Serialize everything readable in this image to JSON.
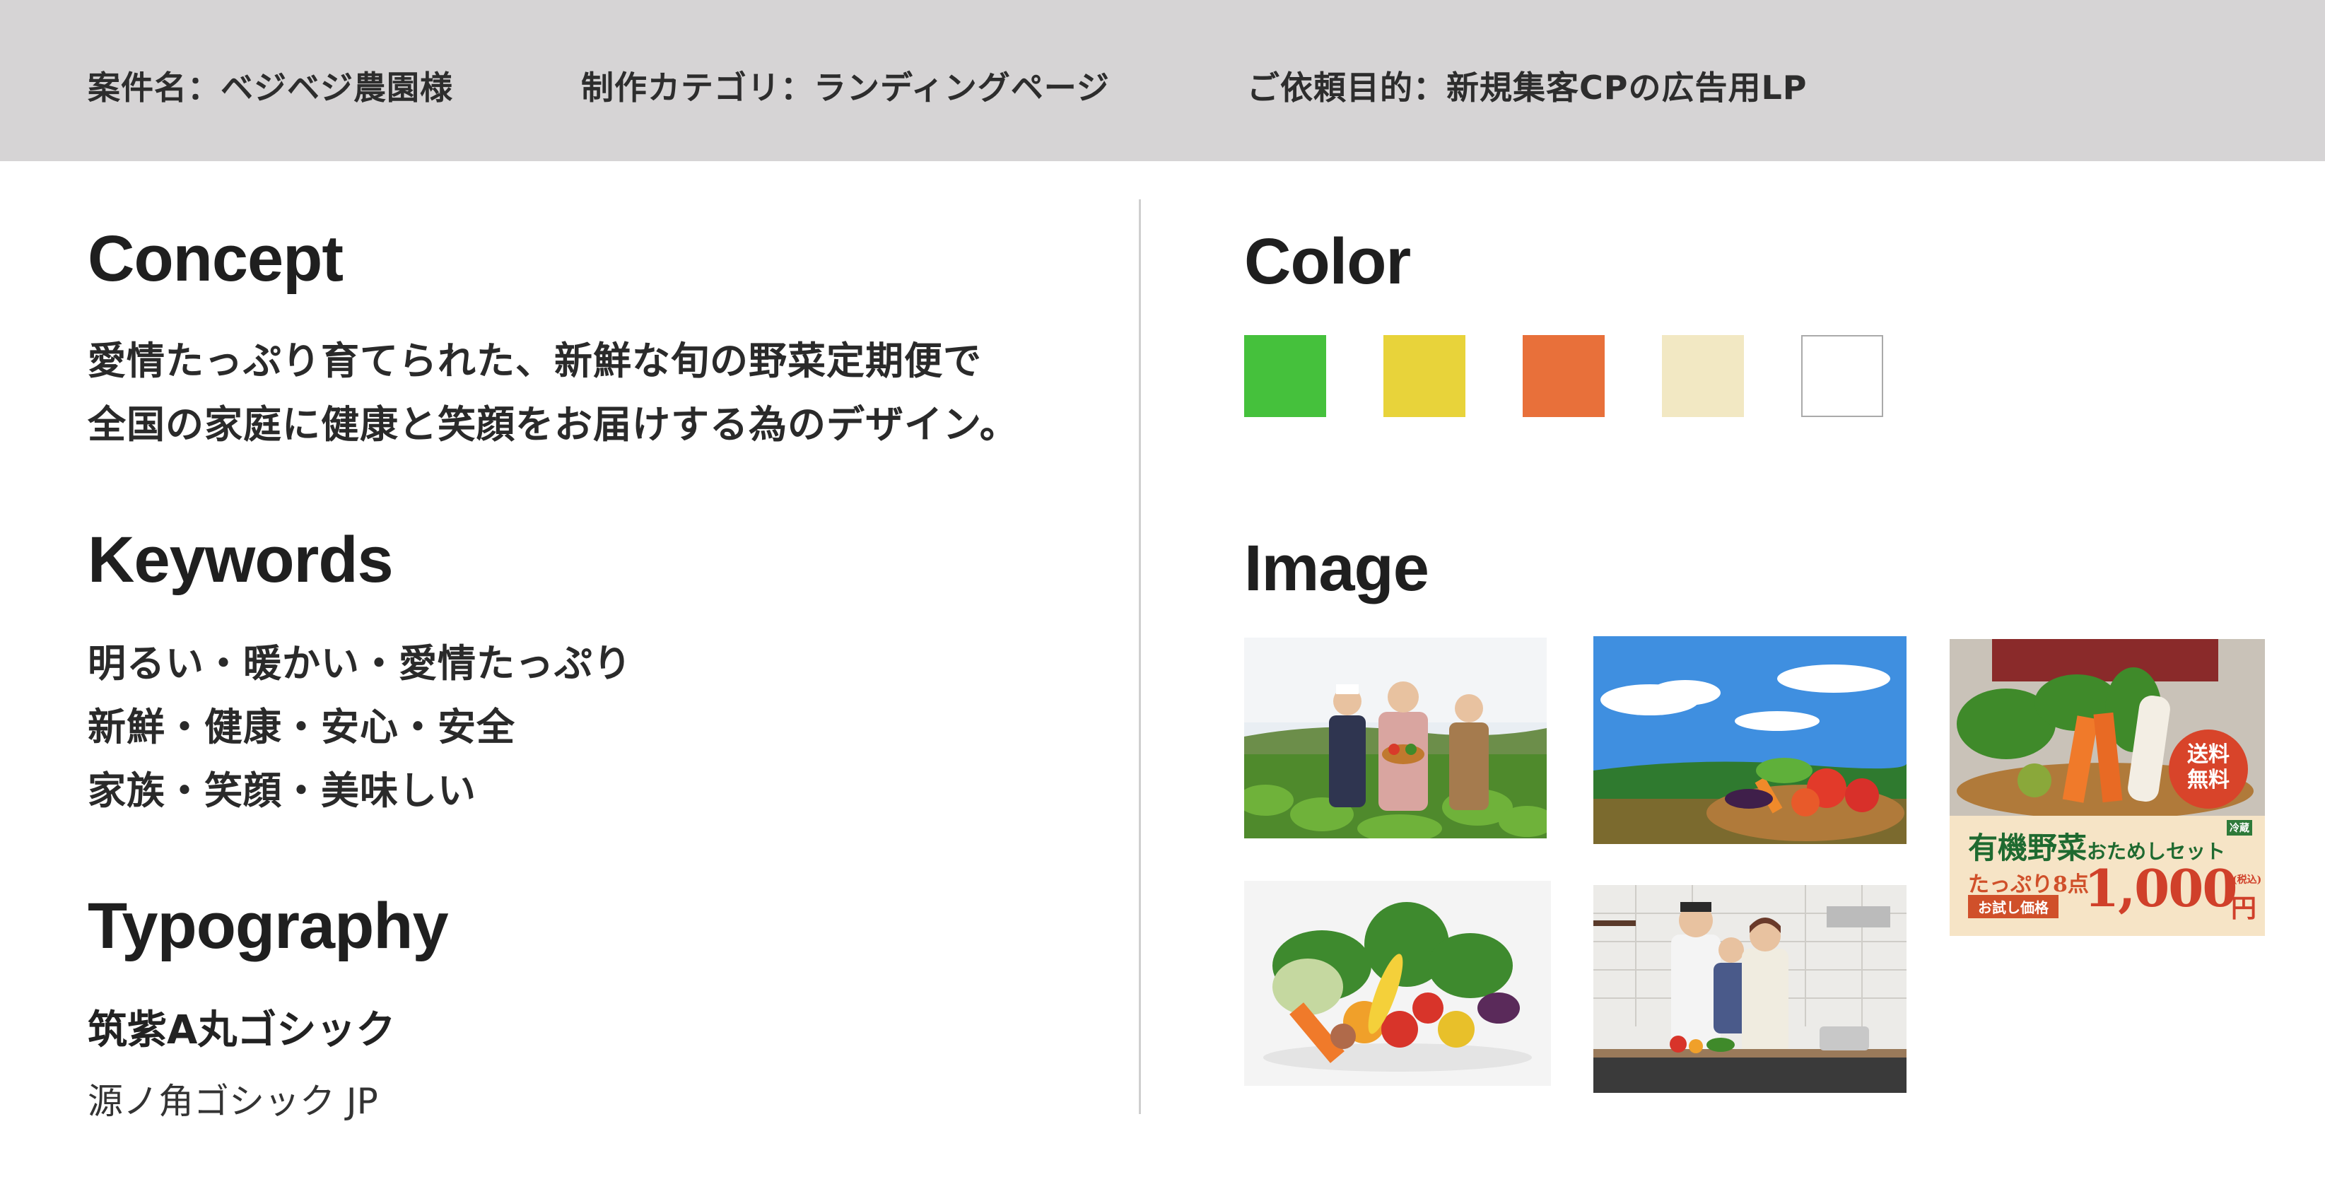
{
  "header": {
    "project": "案件名：ベジベジ農園様",
    "category": "制作カテゴリ：ランディングページ",
    "purpose": "ご依頼目的：新規集客CPの広告用LP"
  },
  "concept": {
    "title": "Concept",
    "lines": [
      "愛情たっぷり育てられた、新鮮な旬の野菜定期便で",
      "全国の家庭に健康と笑顔をお届けする為のデザイン。"
    ]
  },
  "keywords": {
    "title": "Keywords",
    "lines": [
      "明るい・暖かい・愛情たっぷり",
      "新鮮・健康・安心・安全",
      "家族・笑顔・美味しい"
    ]
  },
  "typography": {
    "title": "Typography",
    "fonts": [
      "筑紫A丸ゴシック",
      "源ノ角ゴシック JP"
    ]
  },
  "color": {
    "title": "Color",
    "swatches": [
      "#45c13c",
      "#e8d33a",
      "#e8703a",
      "#f2e8c3",
      "#ffffff"
    ]
  },
  "image": {
    "title": "Image",
    "ad": {
      "badge_line1": "送料",
      "badge_line2": "無料",
      "tag": "冷蔵",
      "headline_main": "有機野菜",
      "headline_sub": "おためしセット",
      "qty": "たっぷり8点",
      "price_label": "お試し価格",
      "price": "1,000",
      "tax": "(税込)",
      "yen": "円"
    }
  }
}
